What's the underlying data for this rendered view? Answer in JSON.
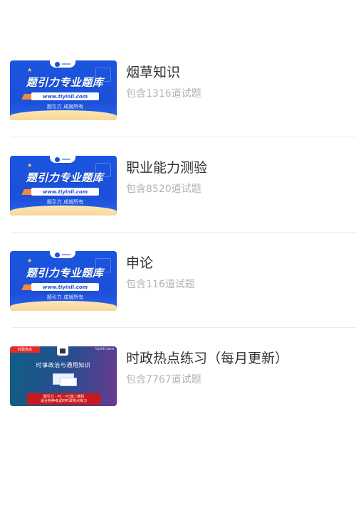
{
  "items": [
    {
      "title": "烟草知识",
      "count_text": "包含1316道试题",
      "thumbnail": {
        "style": "blue",
        "headline": "题引力专业题库",
        "url": "www.tiyinli.com",
        "slogan": "题引力 成就所有"
      }
    },
    {
      "title": "职业能力测验",
      "count_text": "包含8520道试题",
      "thumbnail": {
        "style": "blue",
        "headline": "题引力专业题库",
        "url": "www.tiyinli.com",
        "slogan": "题引力 成就所有"
      }
    },
    {
      "title": "申论",
      "count_text": "包含116道试题",
      "thumbnail": {
        "style": "blue",
        "headline": "题引力专业题库",
        "url": "www.tiyinli.com",
        "slogan": "题引力 成就所有"
      }
    },
    {
      "title": "时政热点练习（每月更新）",
      "count_text": "包含7767道试题",
      "thumbnail": {
        "style": "dark",
        "tag": "时政热点",
        "site": "tiyinli.com",
        "heading": "时事政治与通用知识",
        "box_line1": "题引力 · PC · PC端二维码",
        "box_line2": "适合各种考试的时政热点练习"
      }
    }
  ],
  "colors": {
    "title": "#333333",
    "count": "#b3b3b3",
    "divider": "#ebebeb",
    "banner_blue": "#1d4fd8",
    "banner_cream": "#f8d79a",
    "tag_red": "#e22b2b"
  }
}
